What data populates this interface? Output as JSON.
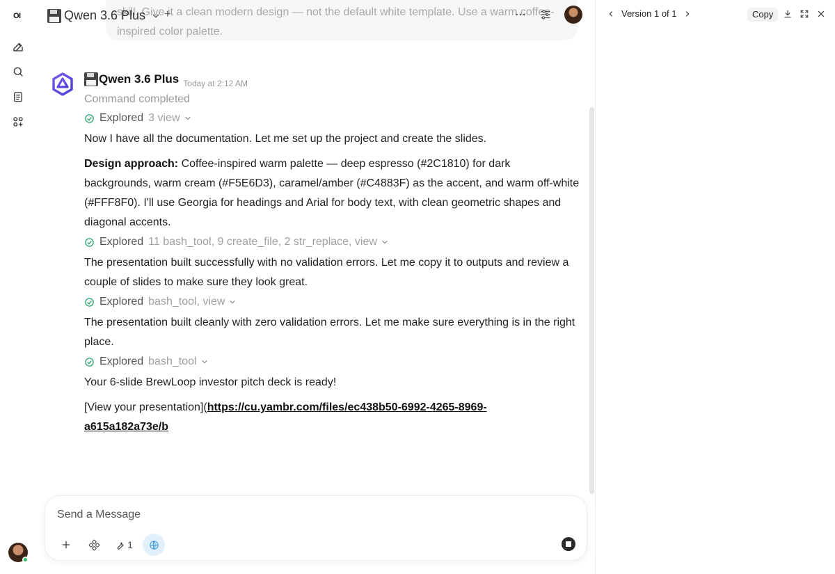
{
  "sidebar": {
    "logo": "OI",
    "items": [
      {
        "name": "new-chat-icon"
      },
      {
        "name": "search-icon"
      },
      {
        "name": "notes-icon"
      },
      {
        "name": "workspace-icon"
      }
    ]
  },
  "header": {
    "model_name": "Qwen 3.6 Plus",
    "add_label": "+"
  },
  "user_message": {
    "text_line1": "skill. Give it a clean modern design — not the default white template. Use a warm coffee-",
    "text_line2": "inspired color palette."
  },
  "assistant": {
    "name": "Qwen 3.6 Plus",
    "time": "Today at 2:12 AM",
    "status": "Command completed",
    "explored_label": "Explored",
    "explored_1": "3 view",
    "para_1": "Now I have all the documentation. Let me set up the project and create the slides.",
    "design_heading": "Design approach:",
    "design_text": " Coffee-inspired warm palette — deep espresso (#2C1810) for dark backgrounds, warm cream (#F5E6D3), caramel/amber (#C4883F) as the accent, and warm off-white (#FFF8F0). I'll use Georgia for headings and Arial for body text, with clean geometric shapes and diagonal accents.",
    "explored_2": "11 bash_tool, 9 create_file, 2 str_replace, view",
    "para_3": "The presentation built successfully with no validation errors. Let me copy it to outputs and review a couple of slides to make sure they look great.",
    "explored_3": "bash_tool, view",
    "para_4": "The presentation built cleanly with zero validation errors. Let me make sure everything is in the right place.",
    "explored_4": "bash_tool",
    "para_5": "Your 6-slide BrewLoop investor pitch deck is ready!",
    "link_prefix": "[View your presentation](",
    "link_url": "https://cu.yambr.com/files/ec438b50-6992-4265-8969-a615a182a73e/b"
  },
  "composer": {
    "placeholder": "Send a Message",
    "tools_count": "1"
  },
  "panel": {
    "version_label": "Version 1 of 1",
    "copy_label": "Copy"
  },
  "colors": {
    "accent_blue": "#3b9be0",
    "check_green": "#22a06b",
    "online_green": "#22c55e"
  }
}
